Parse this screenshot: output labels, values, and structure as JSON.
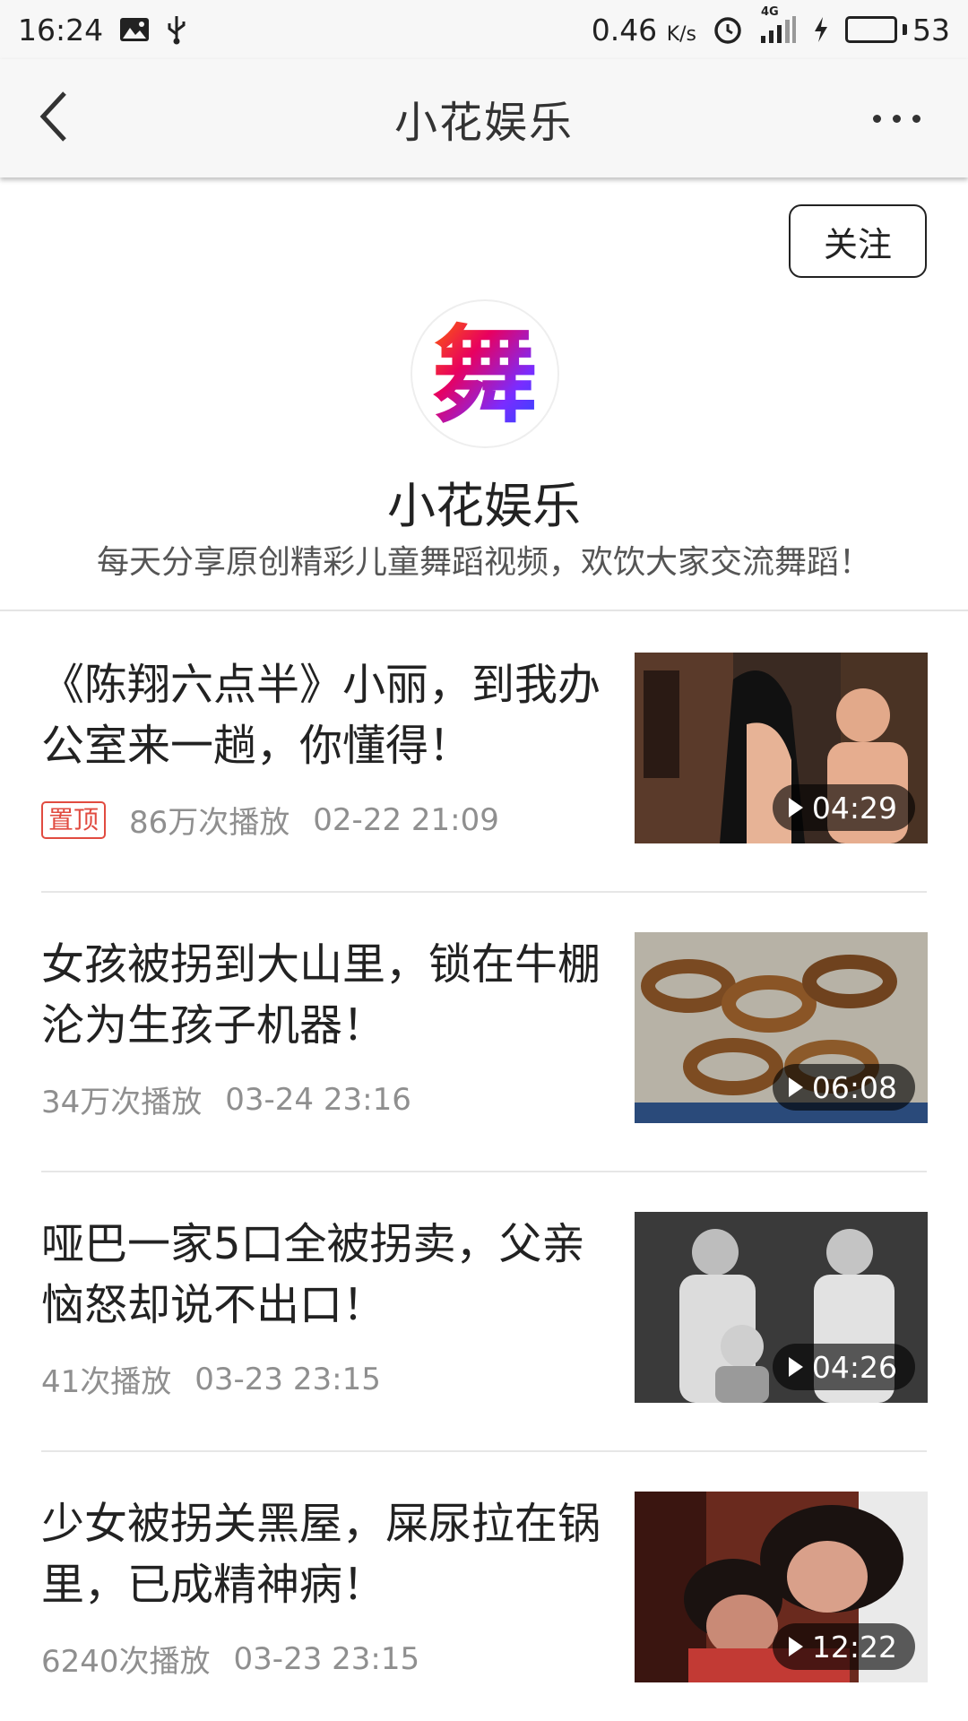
{
  "status_bar": {
    "time": "16:24",
    "net_speed_value": "0.46",
    "net_speed_unit": "K/s",
    "network_type": "4G",
    "battery_level": "53",
    "battery_fill_fraction": 0.53,
    "battery_color": "#29b93c",
    "icons": [
      "image-notification-icon",
      "usb-icon",
      "alarm-icon",
      "signal-icon",
      "charging-icon",
      "battery-icon"
    ]
  },
  "header": {
    "title": "小花娱乐",
    "back_icon": "chevron-left-icon",
    "more_icon": "more-dots-icon"
  },
  "profile": {
    "follow_label": "关注",
    "avatar_glyph": "舞",
    "name": "小花娱乐",
    "description": "每天分享原创精彩儿童舞蹈视频，欢饮大家交流舞蹈！"
  },
  "videos": [
    {
      "title": "《陈翔六点半》小丽，到我办公室来一趟，你懂得！",
      "pinned_label": "置顶",
      "plays": "86万次播放",
      "date": "02-22 21:09",
      "duration": "04:29"
    },
    {
      "title": "女孩被拐到大山里，锁在牛棚沦为生孩子机器！",
      "plays": "34万次播放",
      "date": "03-24 23:16",
      "duration": "06:08"
    },
    {
      "title": "哑巴一家5口全被拐卖，父亲恼怒却说不出口！",
      "plays": "41次播放",
      "date": "03-23 23:15",
      "duration": "04:26"
    },
    {
      "title": "少女被拐关黑屋，屎尿拉在锅里，已成精神病！",
      "plays": "6240次播放",
      "date": "03-23 23:15",
      "duration": "12:22"
    }
  ],
  "colors": {
    "pin_badge": "#e14b40",
    "meta_text": "#8f8f8f",
    "bar_background": "#f7f7f7"
  }
}
